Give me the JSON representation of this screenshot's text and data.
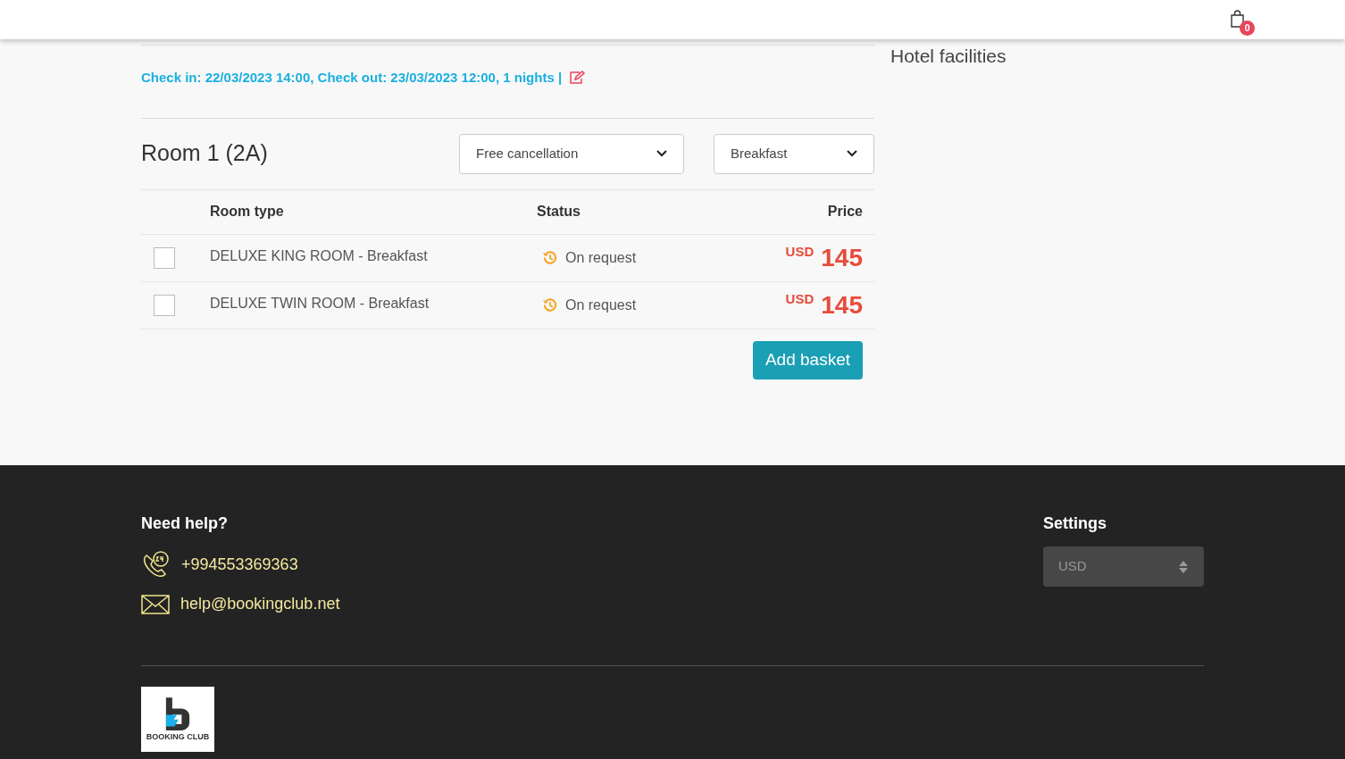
{
  "header": {
    "cart_count": "0"
  },
  "stay": {
    "summary": "Check in: 22/03/2023 14:00, Check out: 23/03/2023 12:00, 1 nights |"
  },
  "sidebar": {
    "title": "Hotel facilities"
  },
  "room": {
    "title": "Room 1 (2A)",
    "filters": [
      {
        "value": "Free cancellation"
      },
      {
        "value": "Breakfast"
      }
    ],
    "columns": [
      "Room type",
      "Status",
      "Price"
    ],
    "rows": [
      {
        "checked": false,
        "room_type": "DELUXE KING ROOM - Breakfast",
        "status": "On request",
        "currency": "USD",
        "price": "145"
      },
      {
        "checked": false,
        "room_type": "DELUXE TWIN ROOM - Breakfast",
        "status": "On request",
        "currency": "USD",
        "price": "145"
      }
    ],
    "button": "Add basket"
  },
  "footer": {
    "help_title": "Need help?",
    "phone": "+994553369363",
    "email": "help@bookingclub.net",
    "settings_title": "Settings",
    "currency": "USD",
    "logo_text": "BOOKING CLUB"
  }
}
